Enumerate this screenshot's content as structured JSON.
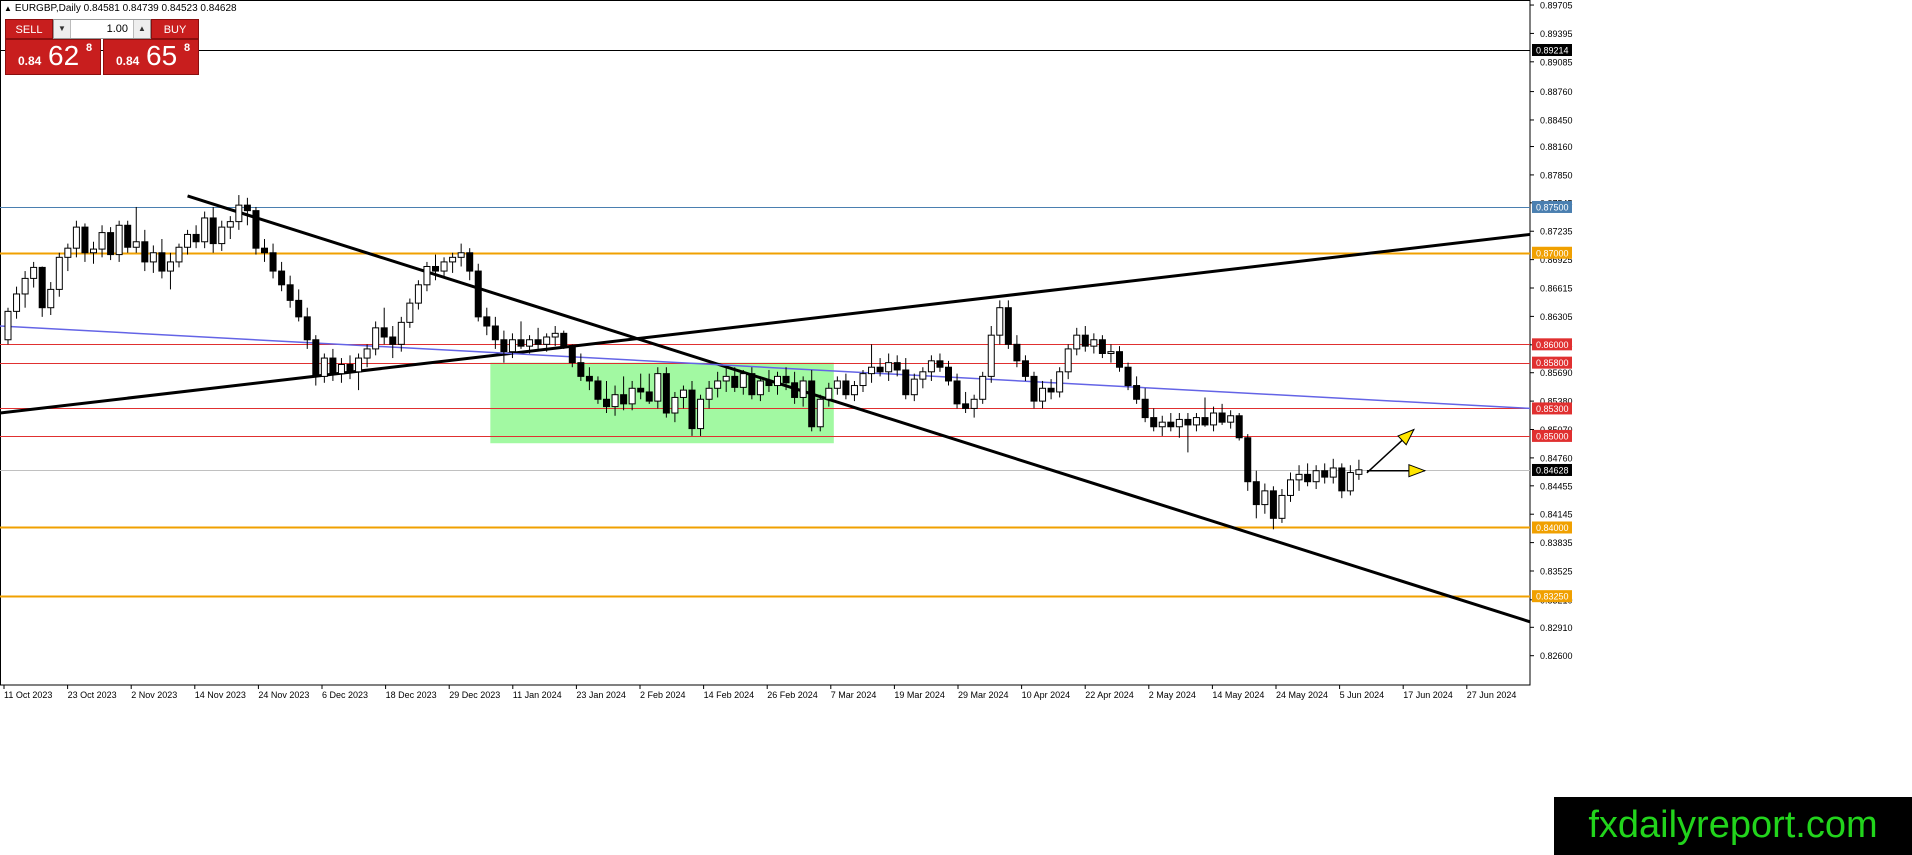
{
  "header": {
    "title": "EURGBP,Daily  0.84581 0.84739 0.84523 0.84628"
  },
  "trade_panel": {
    "sell_label": "SELL",
    "buy_label": "BUY",
    "lot_value": "1.00",
    "sell_small": "0.84",
    "sell_big": "62",
    "sell_sup": "8",
    "buy_small": "0.84",
    "buy_big": "65",
    "buy_sup": "8"
  },
  "watermark": "fxdailyreport.com",
  "chart_data": {
    "type": "candlestick",
    "symbol": "EURGBP",
    "timeframe": "Daily",
    "ohlc_header": {
      "open": 0.84581,
      "high": 0.84739,
      "low": 0.84523,
      "close": 0.84628
    },
    "ylim": [
      0.8228,
      0.8976
    ],
    "y_ticks": [
      "0.89705",
      "0.89395",
      "0.89085",
      "0.88760",
      "0.88450",
      "0.88160",
      "0.87850",
      "0.87545",
      "0.87235",
      "0.86925",
      "0.86615",
      "0.86305",
      "0.85995",
      "0.85690",
      "0.85380",
      "0.85070",
      "0.84760",
      "0.84455",
      "0.84145",
      "0.83835",
      "0.83525",
      "0.83210",
      "0.82910",
      "0.82600"
    ],
    "x_ticks": [
      "11 Oct 2023",
      "23 Oct 2023",
      "2 Nov 2023",
      "14 Nov 2023",
      "24 Nov 2023",
      "6 Dec 2023",
      "18 Dec 2023",
      "29 Dec 2023",
      "11 Jan 2024",
      "23 Jan 2024",
      "2 Feb 2024",
      "14 Feb 2024",
      "26 Feb 2024",
      "7 Mar 2024",
      "19 Mar 2024",
      "29 Mar 2024",
      "10 Apr 2024",
      "22 Apr 2024",
      "2 May 2024",
      "14 May 2024",
      "24 May 2024",
      "5 Jun 2024",
      "17 Jun 2024",
      "27 Jun 2024"
    ],
    "horizontal_levels": [
      {
        "label": "0.89214",
        "value": 0.89214,
        "color": "#000000",
        "tag_bg": "#000000",
        "tag_fg": "#ffffff"
      },
      {
        "label": "0.87500",
        "value": 0.875,
        "color": "#4a7fb0",
        "tag_bg": "#4a7fb0",
        "tag_fg": "#ffffff"
      },
      {
        "label": "0.87000",
        "value": 0.87,
        "color": "#f0a000",
        "tag_bg": "#f0a000",
        "tag_fg": "#ffffff"
      },
      {
        "label": "0.86000",
        "value": 0.86,
        "color": "#e03030",
        "tag_bg": "#e03030",
        "tag_fg": "#ffffff"
      },
      {
        "label": "0.85800",
        "value": 0.858,
        "color": "#e03030",
        "tag_bg": "#e03030",
        "tag_fg": "#ffffff"
      },
      {
        "label": "0.85300",
        "value": 0.853,
        "color": "#e03030",
        "tag_bg": "#e03030",
        "tag_fg": "#ffffff"
      },
      {
        "label": "0.85000",
        "value": 0.85,
        "color": "#e03030",
        "tag_bg": "#e03030",
        "tag_fg": "#ffffff"
      },
      {
        "label": "0.84628",
        "value": 0.84628,
        "color": "#c0c0c0",
        "tag_bg": "#000000",
        "tag_fg": "#ffffff"
      },
      {
        "label": "0.84000",
        "value": 0.84,
        "color": "#f0a000",
        "tag_bg": "#f0a000",
        "tag_fg": "#ffffff"
      },
      {
        "label": "0.83250",
        "value": 0.8325,
        "color": "#f0a000",
        "tag_bg": "#f0a000",
        "tag_fg": "#ffffff"
      }
    ],
    "trendlines": [
      {
        "name": "descending",
        "color": "#000000",
        "from": [
          "14 Nov 2023",
          0.8762
        ],
        "to": [
          "late Jul 2024",
          0.8297
        ]
      },
      {
        "name": "ascending",
        "color": "#000000",
        "from": [
          "2 Oct 2023",
          0.8525
        ],
        "to": [
          "late Jul 2024",
          0.872
        ]
      },
      {
        "name": "moving-average",
        "color": "#6464e6",
        "from": [
          "2 Oct 2023",
          0.862
        ],
        "to": [
          "late Jul 2024",
          0.853
        ]
      }
    ],
    "range_box": {
      "color": "#98f898",
      "from": "23 Jan 2024",
      "to": "4 Apr 2024",
      "high": 0.858,
      "low": 0.8492
    },
    "arrows": [
      {
        "color": "#ffe600",
        "direction": "up"
      },
      {
        "color": "#ffe600",
        "direction": "right"
      }
    ],
    "candles": [
      [
        0.8605,
        0.864,
        0.86,
        0.8636
      ],
      [
        0.8636,
        0.8663,
        0.8628,
        0.8655
      ],
      [
        0.8655,
        0.868,
        0.864,
        0.8672
      ],
      [
        0.8672,
        0.869,
        0.8662,
        0.8684
      ],
      [
        0.8684,
        0.8685,
        0.863,
        0.864
      ],
      [
        0.864,
        0.8668,
        0.8632,
        0.866
      ],
      [
        0.866,
        0.87,
        0.8652,
        0.8695
      ],
      [
        0.8695,
        0.871,
        0.868,
        0.8705
      ],
      [
        0.8705,
        0.8735,
        0.8695,
        0.8728
      ],
      [
        0.8728,
        0.8732,
        0.869,
        0.87
      ],
      [
        0.87,
        0.8712,
        0.8688,
        0.8704
      ],
      [
        0.8704,
        0.873,
        0.8695,
        0.8722
      ],
      [
        0.8722,
        0.8728,
        0.8692,
        0.8698
      ],
      [
        0.8698,
        0.8735,
        0.869,
        0.873
      ],
      [
        0.873,
        0.8735,
        0.87,
        0.8706
      ],
      [
        0.8706,
        0.875,
        0.87,
        0.8712
      ],
      [
        0.8712,
        0.8725,
        0.868,
        0.869
      ],
      [
        0.869,
        0.8708,
        0.8678,
        0.87
      ],
      [
        0.87,
        0.8715,
        0.8672,
        0.868
      ],
      [
        0.868,
        0.87,
        0.866,
        0.869
      ],
      [
        0.869,
        0.871,
        0.8684,
        0.8706
      ],
      [
        0.8706,
        0.8725,
        0.8698,
        0.872
      ],
      [
        0.872,
        0.873,
        0.8705,
        0.8712
      ],
      [
        0.8712,
        0.8745,
        0.8705,
        0.8738
      ],
      [
        0.8738,
        0.875,
        0.87,
        0.871
      ],
      [
        0.871,
        0.8735,
        0.8702,
        0.8728
      ],
      [
        0.8728,
        0.874,
        0.8715,
        0.8734
      ],
      [
        0.8734,
        0.8763,
        0.8725,
        0.8752
      ],
      [
        0.8752,
        0.876,
        0.873,
        0.8746
      ],
      [
        0.8746,
        0.875,
        0.8698,
        0.8705
      ],
      [
        0.8705,
        0.8715,
        0.869,
        0.87
      ],
      [
        0.87,
        0.871,
        0.8672,
        0.868
      ],
      [
        0.868,
        0.869,
        0.8658,
        0.8665
      ],
      [
        0.8665,
        0.8675,
        0.864,
        0.8648
      ],
      [
        0.8648,
        0.866,
        0.8625,
        0.863
      ],
      [
        0.863,
        0.864,
        0.8595,
        0.8605
      ],
      [
        0.8605,
        0.861,
        0.8555,
        0.8565
      ],
      [
        0.8565,
        0.859,
        0.8558,
        0.8585
      ],
      [
        0.8585,
        0.8595,
        0.856,
        0.8568
      ],
      [
        0.8568,
        0.8585,
        0.8558,
        0.8578
      ],
      [
        0.8578,
        0.8588,
        0.8562,
        0.857
      ],
      [
        0.857,
        0.859,
        0.855,
        0.8585
      ],
      [
        0.8585,
        0.86,
        0.8575,
        0.8595
      ],
      [
        0.8595,
        0.8625,
        0.8588,
        0.8618
      ],
      [
        0.8618,
        0.864,
        0.86,
        0.8608
      ],
      [
        0.8608,
        0.862,
        0.8585,
        0.86
      ],
      [
        0.86,
        0.863,
        0.8592,
        0.8624
      ],
      [
        0.8624,
        0.865,
        0.8618,
        0.8645
      ],
      [
        0.8645,
        0.867,
        0.8638,
        0.8665
      ],
      [
        0.8665,
        0.869,
        0.8658,
        0.8685
      ],
      [
        0.8685,
        0.8698,
        0.867,
        0.868
      ],
      [
        0.868,
        0.8695,
        0.8672,
        0.869
      ],
      [
        0.869,
        0.87,
        0.8678,
        0.8695
      ],
      [
        0.8695,
        0.871,
        0.8685,
        0.87
      ],
      [
        0.87,
        0.8705,
        0.867,
        0.868
      ],
      [
        0.868,
        0.8688,
        0.8625,
        0.863
      ],
      [
        0.863,
        0.864,
        0.861,
        0.862
      ],
      [
        0.862,
        0.863,
        0.8595,
        0.8605
      ],
      [
        0.8605,
        0.8615,
        0.858,
        0.8592
      ],
      [
        0.8592,
        0.8612,
        0.8585,
        0.8605
      ],
      [
        0.8605,
        0.8625,
        0.8595,
        0.8598
      ],
      [
        0.8598,
        0.861,
        0.859,
        0.8605
      ],
      [
        0.8605,
        0.8618,
        0.8595,
        0.86
      ],
      [
        0.86,
        0.8612,
        0.8592,
        0.8608
      ],
      [
        0.8608,
        0.862,
        0.8598,
        0.8612
      ],
      [
        0.8612,
        0.8615,
        0.8595,
        0.8598
      ],
      [
        0.8598,
        0.86,
        0.8575,
        0.858
      ],
      [
        0.858,
        0.859,
        0.856,
        0.8565
      ],
      [
        0.8565,
        0.8575,
        0.855,
        0.856
      ],
      [
        0.856,
        0.8565,
        0.8535,
        0.854
      ],
      [
        0.854,
        0.856,
        0.8525,
        0.8532
      ],
      [
        0.8532,
        0.8555,
        0.8522,
        0.8545
      ],
      [
        0.8545,
        0.8565,
        0.8528,
        0.8535
      ],
      [
        0.8535,
        0.856,
        0.8528,
        0.8552
      ],
      [
        0.8552,
        0.8568,
        0.854,
        0.8548
      ],
      [
        0.8548,
        0.8568,
        0.8535,
        0.8538
      ],
      [
        0.8538,
        0.8575,
        0.853,
        0.8568
      ],
      [
        0.8568,
        0.8575,
        0.852,
        0.8525
      ],
      [
        0.8525,
        0.8548,
        0.8515,
        0.8542
      ],
      [
        0.8542,
        0.8555,
        0.853,
        0.855
      ],
      [
        0.855,
        0.856,
        0.85,
        0.8508
      ],
      [
        0.8508,
        0.8545,
        0.85,
        0.854
      ],
      [
        0.854,
        0.856,
        0.853,
        0.8552
      ],
      [
        0.8552,
        0.857,
        0.8542,
        0.856
      ],
      [
        0.856,
        0.8575,
        0.8548,
        0.8565
      ],
      [
        0.8565,
        0.8575,
        0.8548,
        0.8553
      ],
      [
        0.8553,
        0.8572,
        0.8545,
        0.8568
      ],
      [
        0.8568,
        0.8575,
        0.854,
        0.8545
      ],
      [
        0.8545,
        0.8565,
        0.8538,
        0.856
      ],
      [
        0.856,
        0.8572,
        0.8548,
        0.8555
      ],
      [
        0.8555,
        0.857,
        0.8545,
        0.8565
      ],
      [
        0.8565,
        0.8575,
        0.855,
        0.8558
      ],
      [
        0.8558,
        0.857,
        0.8535,
        0.8542
      ],
      [
        0.8542,
        0.8565,
        0.8532,
        0.856
      ],
      [
        0.856,
        0.8572,
        0.8505,
        0.851
      ],
      [
        0.851,
        0.8545,
        0.8505,
        0.854
      ],
      [
        0.854,
        0.8558,
        0.8532,
        0.8552
      ],
      [
        0.8552,
        0.8565,
        0.8545,
        0.856
      ],
      [
        0.856,
        0.8568,
        0.854,
        0.8545
      ],
      [
        0.8545,
        0.856,
        0.8538,
        0.8555
      ],
      [
        0.8555,
        0.8572,
        0.8548,
        0.8568
      ],
      [
        0.8568,
        0.86,
        0.8558,
        0.8575
      ],
      [
        0.8575,
        0.8585,
        0.8565,
        0.857
      ],
      [
        0.857,
        0.859,
        0.856,
        0.858
      ],
      [
        0.858,
        0.8588,
        0.8565,
        0.8572
      ],
      [
        0.8572,
        0.8585,
        0.854,
        0.8545
      ],
      [
        0.8545,
        0.8568,
        0.8538,
        0.8562
      ],
      [
        0.8562,
        0.8575,
        0.8552,
        0.857
      ],
      [
        0.857,
        0.8588,
        0.856,
        0.8582
      ],
      [
        0.8582,
        0.859,
        0.857,
        0.8575
      ],
      [
        0.8575,
        0.8582,
        0.8555,
        0.856
      ],
      [
        0.856,
        0.8568,
        0.853,
        0.8535
      ],
      [
        0.8535,
        0.8548,
        0.8525,
        0.853
      ],
      [
        0.853,
        0.8545,
        0.852,
        0.854
      ],
      [
        0.854,
        0.857,
        0.8535,
        0.8565
      ],
      [
        0.8565,
        0.862,
        0.8558,
        0.861
      ],
      [
        0.861,
        0.8648,
        0.86,
        0.864
      ],
      [
        0.864,
        0.8648,
        0.8595,
        0.86
      ],
      [
        0.86,
        0.861,
        0.8575,
        0.8582
      ],
      [
        0.8582,
        0.8588,
        0.856,
        0.8565
      ],
      [
        0.8565,
        0.857,
        0.853,
        0.8538
      ],
      [
        0.8538,
        0.856,
        0.853,
        0.8552
      ],
      [
        0.8552,
        0.8562,
        0.854,
        0.8548
      ],
      [
        0.8548,
        0.8575,
        0.8542,
        0.857
      ],
      [
        0.857,
        0.86,
        0.8562,
        0.8595
      ],
      [
        0.8595,
        0.8618,
        0.8588,
        0.861
      ],
      [
        0.861,
        0.862,
        0.8592,
        0.8598
      ],
      [
        0.8598,
        0.8612,
        0.859,
        0.8605
      ],
      [
        0.8605,
        0.861,
        0.8585,
        0.859
      ],
      [
        0.859,
        0.86,
        0.858,
        0.8592
      ],
      [
        0.8592,
        0.8598,
        0.857,
        0.8575
      ],
      [
        0.8575,
        0.858,
        0.855,
        0.8555
      ],
      [
        0.8555,
        0.8565,
        0.8535,
        0.854
      ],
      [
        0.854,
        0.8552,
        0.8515,
        0.852
      ],
      [
        0.852,
        0.853,
        0.8505,
        0.851
      ],
      [
        0.851,
        0.8522,
        0.85,
        0.8515
      ],
      [
        0.8515,
        0.8525,
        0.8505,
        0.851
      ],
      [
        0.851,
        0.8525,
        0.8498,
        0.8518
      ],
      [
        0.8518,
        0.8525,
        0.8482,
        0.8512
      ],
      [
        0.8512,
        0.8525,
        0.8505,
        0.852
      ],
      [
        0.852,
        0.8542,
        0.851,
        0.8512
      ],
      [
        0.8512,
        0.8532,
        0.8505,
        0.8525
      ],
      [
        0.8525,
        0.8535,
        0.8512,
        0.8515
      ],
      [
        0.8515,
        0.8528,
        0.8508,
        0.8522
      ],
      [
        0.8522,
        0.8525,
        0.8495,
        0.8498
      ],
      [
        0.8498,
        0.8502,
        0.844,
        0.845
      ],
      [
        0.845,
        0.8462,
        0.841,
        0.8425
      ],
      [
        0.8425,
        0.8448,
        0.8415,
        0.844
      ],
      [
        0.844,
        0.8445,
        0.8398,
        0.841
      ],
      [
        0.841,
        0.8442,
        0.8405,
        0.8435
      ],
      [
        0.8435,
        0.846,
        0.8428,
        0.8452
      ],
      [
        0.8452,
        0.8468,
        0.844,
        0.8458
      ],
      [
        0.8458,
        0.847,
        0.8445,
        0.845
      ],
      [
        0.845,
        0.8468,
        0.8442,
        0.8462
      ],
      [
        0.8462,
        0.847,
        0.8448,
        0.8455
      ],
      [
        0.8455,
        0.8475,
        0.8448,
        0.8465
      ],
      [
        0.8465,
        0.847,
        0.8432,
        0.844
      ],
      [
        0.844,
        0.8468,
        0.8435,
        0.846
      ],
      [
        0.8458,
        0.8474,
        0.8452,
        0.8463
      ]
    ]
  }
}
